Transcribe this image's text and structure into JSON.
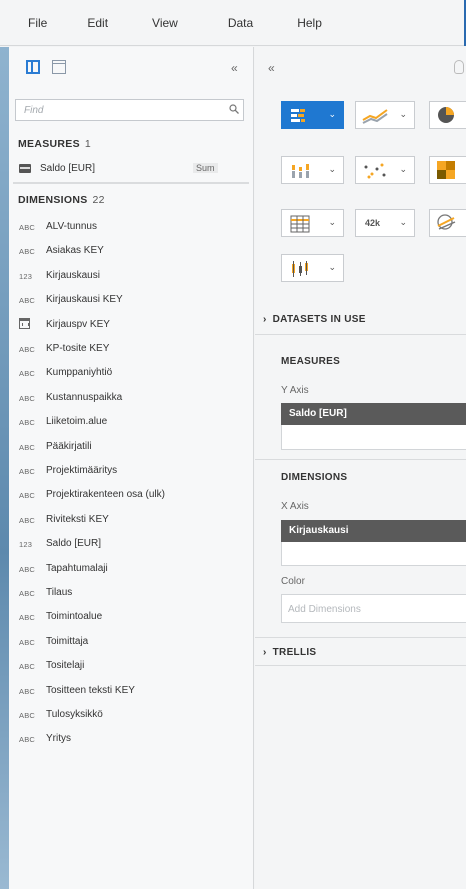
{
  "menu": [
    "File",
    "Edit",
    "View",
    "Data",
    "Help"
  ],
  "left_panel": {
    "collapse_glyph": "«",
    "search": {
      "placeholder": "Find",
      "value": ""
    },
    "measures": {
      "title": "MEASURES",
      "count": "1",
      "items": [
        {
          "label": "Saldo [EUR]",
          "aggregation": "Sum"
        }
      ]
    },
    "dimensions": {
      "title": "DIMENSIONS",
      "count": "22",
      "items": [
        {
          "type": "ABC",
          "label": "ALV-tunnus"
        },
        {
          "type": "ABC",
          "label": "Asiakas KEY"
        },
        {
          "type": "123",
          "label": "Kirjauskausi"
        },
        {
          "type": "ABC",
          "label": "Kirjauskausi KEY"
        },
        {
          "type": "calendar",
          "label": "Kirjauspv KEY"
        },
        {
          "type": "ABC",
          "label": "KP-tosite KEY"
        },
        {
          "type": "ABC",
          "label": "Kumppaniyhtiö"
        },
        {
          "type": "ABC",
          "label": "Kustannuspaikka"
        },
        {
          "type": "ABC",
          "label": "Liiketoim.alue"
        },
        {
          "type": "ABC",
          "label": "Pääkirjatili"
        },
        {
          "type": "ABC",
          "label": "Projektimääritys"
        },
        {
          "type": "ABC",
          "label": "Projektirakenteen osa (ulk)"
        },
        {
          "type": "ABC",
          "label": "Riviteksti KEY"
        },
        {
          "type": "123",
          "label": "Saldo [EUR]"
        },
        {
          "type": "ABC",
          "label": "Tapahtumalaji"
        },
        {
          "type": "ABC",
          "label": "Tilaus"
        },
        {
          "type": "ABC",
          "label": "Toimintoalue"
        },
        {
          "type": "ABC",
          "label": "Toimittaja"
        },
        {
          "type": "ABC",
          "label": "Tositelaji"
        },
        {
          "type": "ABC",
          "label": "Tositteen teksti KEY"
        },
        {
          "type": "ABC",
          "label": "Tulosyksikkö"
        },
        {
          "type": "ABC",
          "label": "Yritys"
        }
      ]
    }
  },
  "right_panel": {
    "collapse_glyph": "«",
    "chart_types": [
      {
        "name": "bar-chart",
        "selected": true
      },
      {
        "name": "line-chart",
        "selected": false
      },
      {
        "name": "pie-chart",
        "selected": false
      },
      {
        "name": "column-chart",
        "selected": false
      },
      {
        "name": "scatter-chart",
        "selected": false
      },
      {
        "name": "heatmap-chart",
        "selected": false
      },
      {
        "name": "table-chart",
        "selected": false
      },
      {
        "name": "numeric-point-chart",
        "selected": false,
        "text": "42k"
      },
      {
        "name": "geo-chart",
        "selected": false
      },
      {
        "name": "boxplot-chart",
        "selected": false
      }
    ],
    "datasets_in_use": "DATASETS IN USE",
    "measures_title": "MEASURES",
    "y_axis_label": "Y Axis",
    "y_axis_value": "Saldo [EUR]",
    "dimensions_title": "DIMENSIONS",
    "x_axis_label": "X Axis",
    "x_axis_value": "Kirjauskausi",
    "color_label": "Color",
    "color_placeholder": "Add Dimensions",
    "trellis": "TRELLIS"
  },
  "colors": {
    "accent": "#1f78d1",
    "pill": "#5a5a5a"
  }
}
